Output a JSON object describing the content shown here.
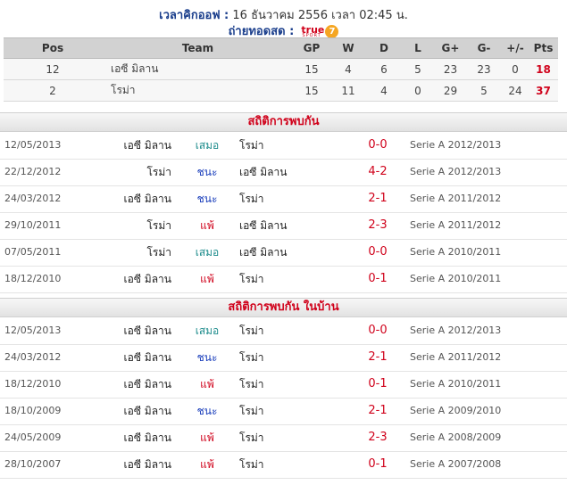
{
  "header": {
    "kickoff_label": "เวลาคิกออฟ :",
    "kickoff_value": "16 ธันวาคม 2556 เวลา 02:45 น.",
    "broadcast_label": "ถ่ายทอดสด :",
    "broadcast_logo_text": "true",
    "broadcast_logo_sub": "SPORT",
    "broadcast_logo_num": "7"
  },
  "league_table": {
    "columns": [
      "Pos",
      "Team",
      "GP",
      "W",
      "D",
      "L",
      "G+",
      "G-",
      "+/-",
      "Pts"
    ],
    "rows": [
      {
        "pos": "12",
        "team": "เอซี มิลาน",
        "gp": "15",
        "w": "4",
        "d": "6",
        "l": "5",
        "gf": "23",
        "ga": "23",
        "gd": "0",
        "pts": "18"
      },
      {
        "pos": "2",
        "team": "โรม่า",
        "gp": "15",
        "w": "11",
        "d": "4",
        "l": "0",
        "gf": "29",
        "ga": "5",
        "gd": "24",
        "pts": "37"
      }
    ]
  },
  "h2h": {
    "title": "สถิติการพบกัน",
    "matches": [
      {
        "date": "12/05/2013",
        "home": "เอซี มิลาน",
        "result": "เสมอ",
        "result_type": "draw",
        "away": "โรม่า",
        "score": "0-0",
        "competition": "Serie A 2012/2013"
      },
      {
        "date": "22/12/2012",
        "home": "โรม่า",
        "result": "ชนะ",
        "result_type": "win",
        "away": "เอซี มิลาน",
        "score": "4-2",
        "competition": "Serie A 2012/2013"
      },
      {
        "date": "24/03/2012",
        "home": "เอซี มิลาน",
        "result": "ชนะ",
        "result_type": "win",
        "away": "โรม่า",
        "score": "2-1",
        "competition": "Serie A 2011/2012"
      },
      {
        "date": "29/10/2011",
        "home": "โรม่า",
        "result": "แพ้",
        "result_type": "lose",
        "away": "เอซี มิลาน",
        "score": "2-3",
        "competition": "Serie A 2011/2012"
      },
      {
        "date": "07/05/2011",
        "home": "โรม่า",
        "result": "เสมอ",
        "result_type": "draw",
        "away": "เอซี มิลาน",
        "score": "0-0",
        "competition": "Serie A 2010/2011"
      },
      {
        "date": "18/12/2010",
        "home": "เอซี มิลาน",
        "result": "แพ้",
        "result_type": "lose",
        "away": "โรม่า",
        "score": "0-1",
        "competition": "Serie A 2010/2011"
      }
    ]
  },
  "h2h_home": {
    "title": "สถิติการพบกัน ในบ้าน",
    "matches": [
      {
        "date": "12/05/2013",
        "home": "เอซี มิลาน",
        "result": "เสมอ",
        "result_type": "draw",
        "away": "โรม่า",
        "score": "0-0",
        "competition": "Serie A 2012/2013"
      },
      {
        "date": "24/03/2012",
        "home": "เอซี มิลาน",
        "result": "ชนะ",
        "result_type": "win",
        "away": "โรม่า",
        "score": "2-1",
        "competition": "Serie A 2011/2012"
      },
      {
        "date": "18/12/2010",
        "home": "เอซี มิลาน",
        "result": "แพ้",
        "result_type": "lose",
        "away": "โรม่า",
        "score": "0-1",
        "competition": "Serie A 2010/2011"
      },
      {
        "date": "18/10/2009",
        "home": "เอซี มิลาน",
        "result": "ชนะ",
        "result_type": "win",
        "away": "โรม่า",
        "score": "2-1",
        "competition": "Serie A 2009/2010"
      },
      {
        "date": "24/05/2009",
        "home": "เอซี มิลาน",
        "result": "แพ้",
        "result_type": "lose",
        "away": "โรม่า",
        "score": "2-3",
        "competition": "Serie A 2008/2009"
      },
      {
        "date": "28/10/2007",
        "home": "เอซี มิลาน",
        "result": "แพ้",
        "result_type": "lose",
        "away": "โรม่า",
        "score": "0-1",
        "competition": "Serie A 2007/2008"
      }
    ]
  }
}
